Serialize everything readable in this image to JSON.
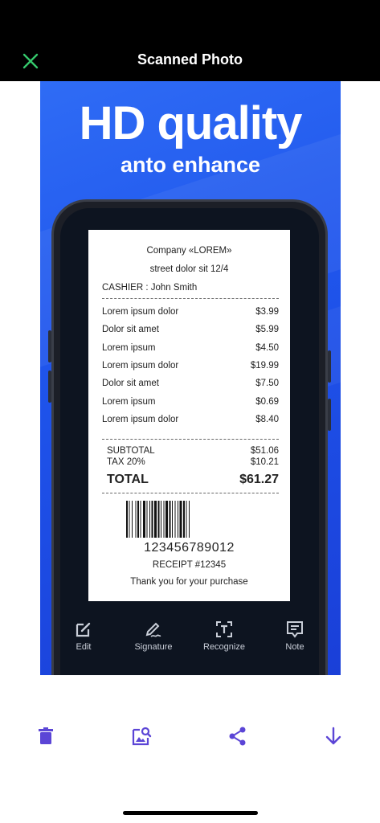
{
  "header": {
    "title": "Scanned Photo"
  },
  "promo": {
    "headline": "HD quality",
    "subline": "anto enhance"
  },
  "receipt": {
    "company": "Company «LOREM»",
    "address": "street dolor sit 12/4",
    "cashier": "CASHIER : John Smith",
    "items": [
      {
        "name": "Lorem ipsum dolor",
        "price": "$3.99"
      },
      {
        "name": "Dolor sit amet",
        "price": "$5.99"
      },
      {
        "name": "Lorem ipsum",
        "price": "$4.50"
      },
      {
        "name": "Lorem ipsum dolor",
        "price": "$19.99"
      },
      {
        "name": "Dolor sit amet",
        "price": "$7.50"
      },
      {
        "name": "Lorem ipsum",
        "price": "$0.69"
      },
      {
        "name": "Lorem ipsum dolor",
        "price": "$8.40"
      }
    ],
    "subtotal_label": "SUBTOTAL",
    "subtotal_value": "$51.06",
    "tax_label": "TAX 20%",
    "tax_value": "$10.21",
    "total_label": "TOTAL",
    "total_value": "$61.27",
    "barcode_number": "123456789012",
    "receipt_no": "RECEIPT #12345",
    "thanks": "Thank you for your purchase"
  },
  "tools": {
    "edit": "Edit",
    "signature": "Signature",
    "recognize": "Recognize",
    "note": "Note"
  },
  "colors": {
    "accent": "#5b45d6",
    "close": "#35c76b",
    "promo_bg": "#1f55ec"
  }
}
